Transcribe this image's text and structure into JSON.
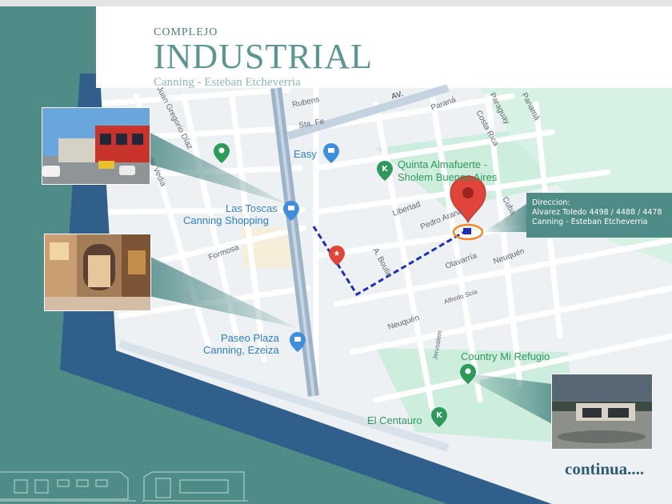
{
  "title": {
    "small": "COMPLEJO",
    "big": "INDUSTRIAL",
    "sub": "Canning - Esteban Etcheverria"
  },
  "info_box": {
    "label": "Direccion:",
    "address": "Alvarez Toledo 4498 / 4488 / 4478",
    "locality": "Canning - Esteban Etcheverria"
  },
  "footer": {
    "continue_label": "continua...."
  },
  "map": {
    "places": {
      "las_toscas_1": "Las Toscas",
      "las_toscas_2": "Canning Shopping",
      "easy": "Easy",
      "quinta_1": "Quinta Almafuerte -",
      "quinta_2": "Sholem Buenos Aires",
      "paseo_1": "Paseo Plaza",
      "paseo_2": "Canning, Ezeiza",
      "country": "Country Mi Refugio",
      "centauro": "El Centauro"
    },
    "streets": {
      "rubens": "Rubens",
      "sta_fe": "Sta. Fe",
      "av": "AV.",
      "parana": "Paraná",
      "costa_rica": "Costa Rica",
      "paraguay": "Paraguay",
      "panama": "Panamá",
      "juan_gregorio": "Juan Gregorio Díaz",
      "vedia": "de Vedia",
      "libertad": "Libertad",
      "pedro": "Pedro Arana",
      "cuba": "Cuba",
      "formosa": "Formosa",
      "boulin": "A. Boulin",
      "olavarria": "Olavarría",
      "neuquen_1": "Neuquén",
      "neuquen_2": "Neuquén",
      "alfredo": "Alfredo Scia",
      "jerusalem": "Jerusalem"
    }
  },
  "colors": {
    "teal": "#4f8b87",
    "navy": "#2f5f8a",
    "map_bg": "#eef1f4",
    "green_area": "#cdeedd",
    "pin_red": "#e0443a",
    "route": "#1b2fb8",
    "marker_orange": "#f08a2a"
  },
  "icons": [
    "map-pin-icon",
    "shopping-bag-icon",
    "park-pin-icon",
    "sports-pin-icon",
    "star-pin-icon",
    "building-marker-icon"
  ]
}
